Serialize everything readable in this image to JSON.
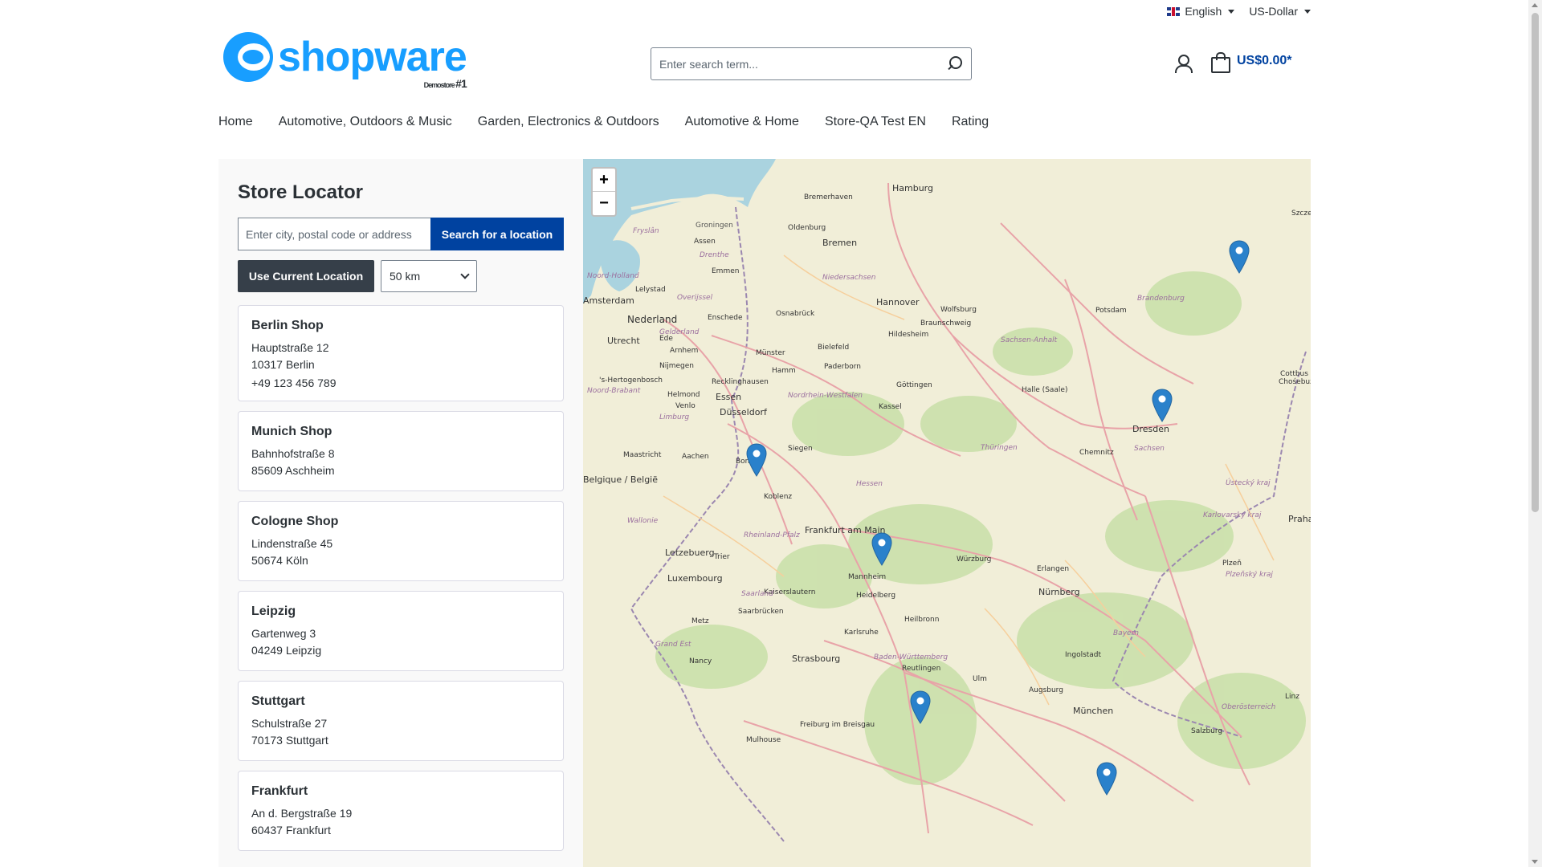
{
  "topbar": {
    "language": "English",
    "currency": "US-Dollar"
  },
  "logo": {
    "text": "shopware",
    "sub": "Demostore",
    "rank": "#1"
  },
  "search": {
    "placeholder": "Enter search term..."
  },
  "cart": {
    "total": "US$0.00*"
  },
  "nav": [
    "Home",
    "Automotive, Outdoors & Music",
    "Garden, Electronics & Outdoors",
    "Automotive & Home",
    "Store-QA Test EN",
    "Rating"
  ],
  "locator": {
    "title": "Store Locator",
    "input_placeholder": "Enter city, postal code or address",
    "search_button": "Search for a location",
    "current_location_button": "Use Current Location",
    "radius": "50 km"
  },
  "stores": [
    {
      "name": "Berlin Shop",
      "street": "Hauptstraße 12",
      "city": "10317 Berlin",
      "phone": "+49 123 456 789"
    },
    {
      "name": "Munich Shop",
      "street": "Bahnhofstraße 8",
      "city": "85609 Aschheim",
      "phone": ""
    },
    {
      "name": "Cologne Shop",
      "street": "Lindenstraße 45",
      "city": "50674 Köln",
      "phone": ""
    },
    {
      "name": "Leipzig",
      "street": "Gartenweg 3",
      "city": "04249 Leipzig",
      "phone": ""
    },
    {
      "name": "Stuttgart",
      "street": "Schulstraße 27",
      "city": "70173 Stuttgart",
      "phone": ""
    },
    {
      "name": "Frankfurt",
      "street": "An d. Bergstraße 19",
      "city": "60437 Frankfurt",
      "phone": ""
    }
  ],
  "map": {
    "zoom_in": "+",
    "zoom_out": "−",
    "colors": {
      "land": "#f1eed8",
      "water": "#aad3df",
      "forest": "#c8dfa8",
      "road": "#e8a3a8",
      "marker": "#2a81cb"
    },
    "labels": [
      "Hamburg",
      "Bremerhaven",
      "Groningen",
      "Oldenburg",
      "Bremen",
      "Assen",
      "Fryslân",
      "Drenthe",
      "Emmen",
      "Niedersachsen",
      "Noord-Holland",
      "Lelystad",
      "Overijssel",
      "Amsterdam",
      "Nederland",
      "Enschede",
      "Osnabrück",
      "Hannover",
      "Wolfsburg",
      "Braunschweig",
      "Potsdam",
      "Brandenburg",
      "Utrecht",
      "Gelderland",
      "Ede",
      "Arnhem",
      "Münster",
      "Bielefeld",
      "Hildesheim",
      "Sachsen-Anhalt",
      "Nijmegen",
      "Hamm",
      "Paderborn",
      "'s-Hertogenbosch",
      "Recklinghausen",
      "Göttingen",
      "Noord-Brabant",
      "Helmond",
      "Essen",
      "Nordrhein-Westfalen",
      "Halle (Saale)",
      "Cottbus",
      "Chośebuz",
      "Venlo",
      "Limburg",
      "Düsseldorf",
      "Kassel",
      "Dresden",
      "Maastricht",
      "Aachen",
      "Siegen",
      "Thüringen",
      "Chemnitz",
      "Sachsen",
      "Bonn",
      "Belgique / België",
      "Hessen",
      "Ústecký kraj",
      "Koblenz",
      "Wallonie",
      "Frankfurt am Main",
      "Karlovarský kraj",
      "Praha",
      "Rheinland-Pfalz",
      "Letzebuerg",
      "Trier",
      "Würzburg",
      "Plzeň",
      "Luxembourg",
      "Mannheim",
      "Erlangen",
      "Kaiserslautern",
      "Heidelberg",
      "Nürnberg",
      "Plzeňský kraj",
      "Saarland",
      "Saarbrücken",
      "Heilbronn",
      "Metz",
      "Karlsruhe",
      "Bayern",
      "Grand Est",
      "Baden-Württemberg",
      "Ingolstadt",
      "Nancy",
      "Strasbourg",
      "Reutlingen",
      "Ulm",
      "Augsburg",
      "Linz",
      "München",
      "Oberösterreich",
      "Freiburg im Breisgau",
      "Mulhouse",
      "Salzburg",
      "Szczecin"
    ]
  }
}
